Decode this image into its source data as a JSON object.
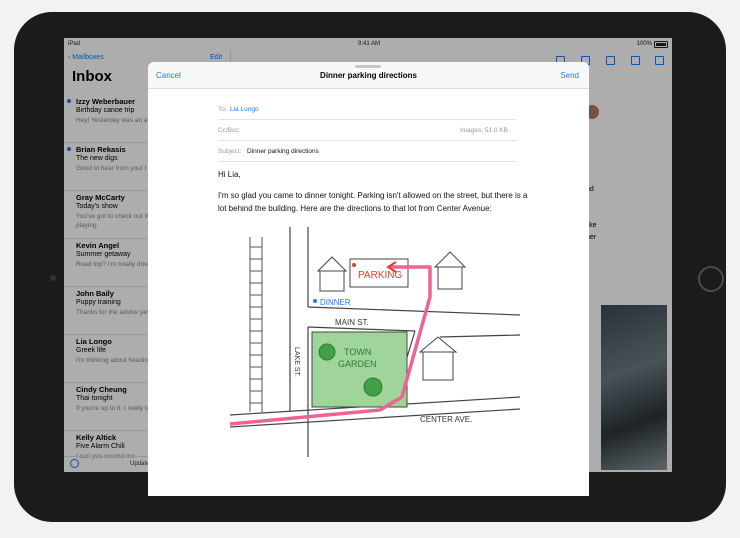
{
  "status": {
    "device": "iPad",
    "time": "9:41 AM",
    "battery": "100%"
  },
  "sidebar": {
    "back_label": "Mailboxes",
    "edit_label": "Edit",
    "title": "Inbox",
    "footer": "Updated Just Now",
    "items": [
      {
        "from": "Izzy Weberbauer",
        "subject": "Birthday canoe trip",
        "preview": "Hey! Yesterday was an amazing time at my birthday"
      },
      {
        "from": "Brian Rekasis",
        "subject": "The new digs",
        "preview": "Good to hear from you! I saw yesterday"
      },
      {
        "from": "Gray McCarty",
        "subject": "Today's show",
        "preview": "You've got to check out the show. I can't stop playing"
      },
      {
        "from": "Kevin Angel",
        "subject": "Summer getaway",
        "preview": "Road trip? I'm totally down to go me out of the city"
      },
      {
        "from": "John Baily",
        "subject": "Puppy training",
        "preview": "Thanks for the advice yesterday worked out"
      },
      {
        "from": "Lia Longo",
        "subject": "Greek life",
        "preview": "I'm thinking about heading this fall"
      },
      {
        "from": "Cindy Cheung",
        "subject": "Thai tonight",
        "preview": "If you're up to it, I really tonight. Want to fire"
      },
      {
        "from": "Kelly Altick",
        "subject": "Five Alarm Chili",
        "preview": "I can you resend me"
      }
    ]
  },
  "detail_snippets": [
    "nd",
    "like",
    "ner"
  ],
  "compose": {
    "cancel_label": "Cancel",
    "title": "Dinner parking directions",
    "send_label": "Send",
    "to_label": "To:",
    "to_value": "Lia Longo",
    "cc_label": "Cc/Bcc:",
    "images_info": "Images: 51.0 KB",
    "subject_label": "Subject:",
    "subject_value": "Dinner parking directions",
    "greeting": "Hi Lia,",
    "body": "I'm so glad you came to dinner tonight. Parking isn't allowed on the street, but there is a lot behind the building. Here are the directions to that lot from Center Avenue:"
  },
  "map": {
    "labels": {
      "parking": "PARKING",
      "dinner": "DINNER",
      "main_st": "MAIN ST.",
      "town_garden_1": "TOWN",
      "town_garden_2": "GARDEN",
      "lake_st": "LAKE ST.",
      "center_ave": "CENTER AVE."
    }
  },
  "colors": {
    "accent": "#1a7cf4",
    "route": "#f06292",
    "garden": "#9fd49b"
  }
}
